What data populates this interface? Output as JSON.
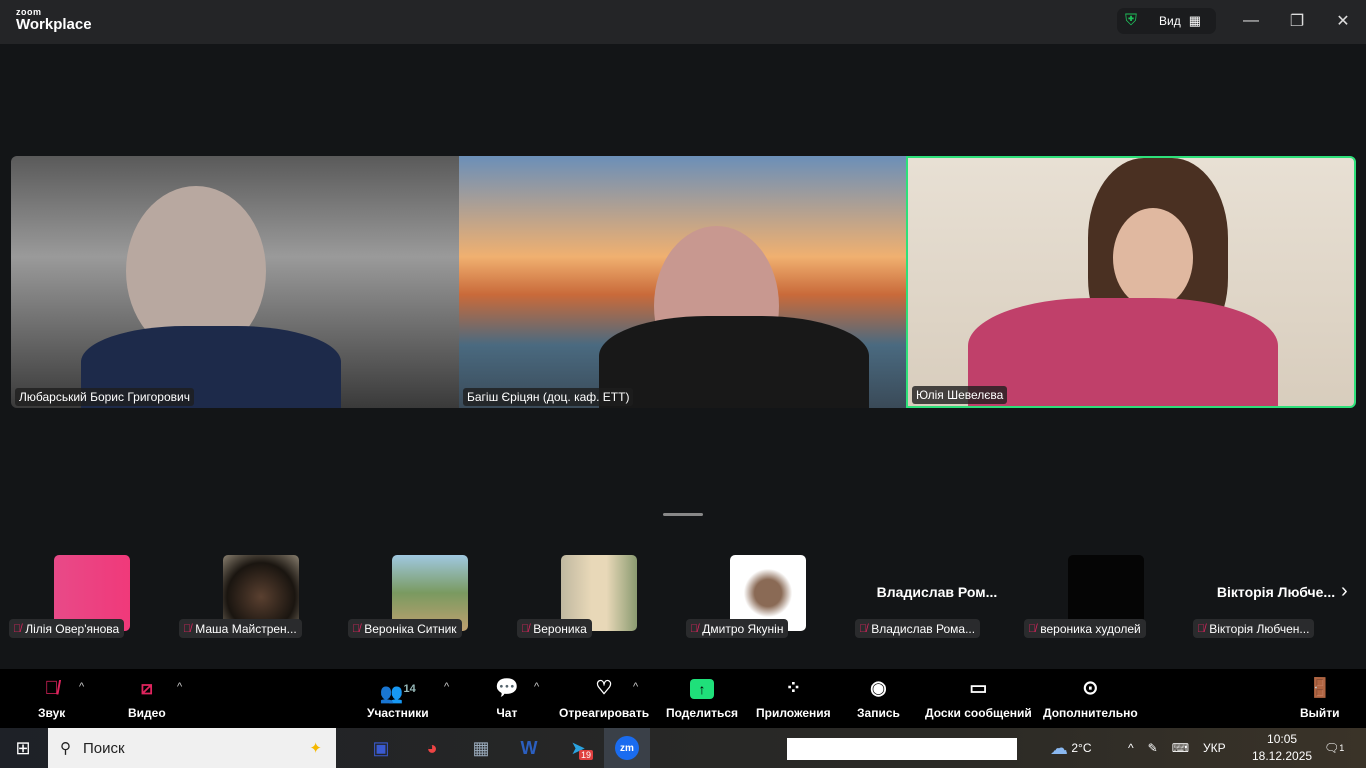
{
  "titlebar": {
    "logo_small": "zoom",
    "logo_big": "Workplace",
    "view_label": "Вид"
  },
  "videos": [
    {
      "name": "Любарський Борис Григорович"
    },
    {
      "name": "Багіш Єріцян (доц. каф. ЕТТ)"
    },
    {
      "name": "Юлія Шевелєва"
    }
  ],
  "gallery": [
    {
      "name": "Лілія Овер'янова",
      "color": "#f0397a"
    },
    {
      "name": "Маша Майстрен..."
    },
    {
      "name": "Вероніка Ситник"
    },
    {
      "name": "Вероника"
    },
    {
      "name": "Дмитро Якунін"
    },
    {
      "name": "Владислав Рома...",
      "display": "Владислав Ром..."
    },
    {
      "name": "вероника худолей"
    },
    {
      "name": "Вікторія Любчен...",
      "display": "Вікторія Любче..."
    }
  ],
  "toolbar": {
    "audio": "Звук",
    "video": "Видео",
    "participants": "Участники",
    "participants_count": "14",
    "chat": "Чат",
    "react": "Отреагировать",
    "share": "Поделиться",
    "apps": "Приложения",
    "record": "Запись",
    "whiteboards": "Доски сообщений",
    "more": "Дополнительно",
    "leave": "Выйти"
  },
  "taskbar": {
    "search_placeholder": "Поиск",
    "telegram_badge": "19",
    "weather": "2°C",
    "lang": "УКР",
    "time": "10:05",
    "date": "18.12.2025",
    "notifications": "1"
  }
}
